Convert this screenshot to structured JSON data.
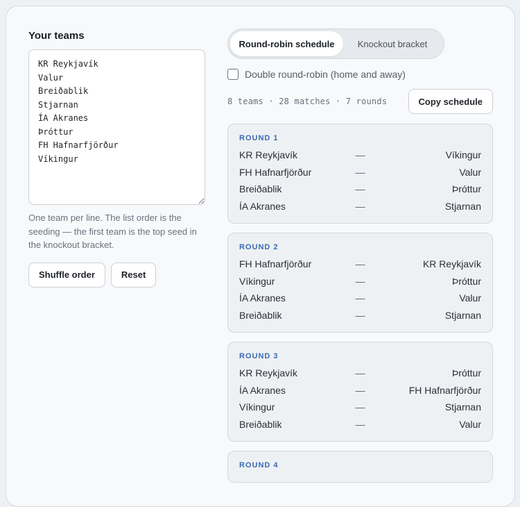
{
  "left": {
    "heading": "Your teams",
    "teams_text": "KR Reykjavík\nValur\nBreiðablik\nStjarnan\nÍA Akranes\nÞróttur\nFH Hafnarfjörður\nVíkingur",
    "hint": "One team per line. The list order is the seeding — the first team is the top seed in the knockout bracket.",
    "shuffle_label": "Shuffle order",
    "reset_label": "Reset"
  },
  "tabs": [
    {
      "label": "Round-robin schedule",
      "active": true
    },
    {
      "label": "Knockout bracket",
      "active": false
    }
  ],
  "double_rr": {
    "label": "Double round-robin (home and away)",
    "checked": false
  },
  "stats": "8 teams · 28 matches · 7 rounds",
  "copy_label": "Copy schedule",
  "separator": "—",
  "rounds": [
    {
      "title": "ROUND 1",
      "matches": [
        {
          "home": "KR Reykjavík",
          "away": "Víkingur"
        },
        {
          "home": "FH Hafnarfjörður",
          "away": "Valur"
        },
        {
          "home": "Breiðablik",
          "away": "Þróttur"
        },
        {
          "home": "ÍA Akranes",
          "away": "Stjarnan"
        }
      ]
    },
    {
      "title": "ROUND 2",
      "matches": [
        {
          "home": "FH Hafnarfjörður",
          "away": "KR Reykjavík"
        },
        {
          "home": "Víkingur",
          "away": "Þróttur"
        },
        {
          "home": "ÍA Akranes",
          "away": "Valur"
        },
        {
          "home": "Breiðablik",
          "away": "Stjarnan"
        }
      ]
    },
    {
      "title": "ROUND 3",
      "matches": [
        {
          "home": "KR Reykjavík",
          "away": "Þróttur"
        },
        {
          "home": "ÍA Akranes",
          "away": "FH Hafnarfjörður"
        },
        {
          "home": "Víkingur",
          "away": "Stjarnan"
        },
        {
          "home": "Breiðablik",
          "away": "Valur"
        }
      ]
    },
    {
      "title": "ROUND 4",
      "matches": []
    }
  ]
}
